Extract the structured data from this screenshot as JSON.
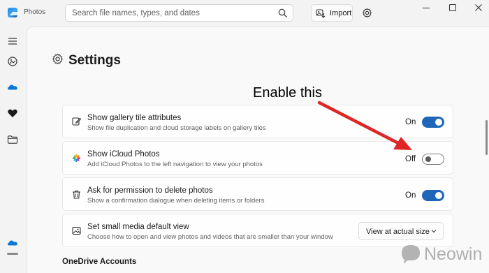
{
  "titlebar": {
    "app_title": "Photos",
    "search_placeholder": "Search file names, types, and dates",
    "import_label": "Import"
  },
  "page": {
    "title": "Settings",
    "annotation": "Enable this"
  },
  "settings": [
    {
      "title": "Show gallery tile attributes",
      "subtitle": "Show file duplication and cloud storage labels on gallery tiles",
      "toggle_label": "On",
      "toggle_state": true,
      "icon": "edit-icon"
    },
    {
      "title": "Show iCloud Photos",
      "subtitle": "Add iCloud Photos to the left navigation to view your photos",
      "toggle_label": "Off",
      "toggle_state": false,
      "icon": "icloud-photos-icon"
    },
    {
      "title": "Ask for permission to delete photos",
      "subtitle": "Show a confirmation dialogue when deleting items or folders",
      "toggle_label": "On",
      "toggle_state": true,
      "icon": "trash-icon"
    },
    {
      "title": "Set small media default view",
      "subtitle": "Choose how to open and view photos and videos that are smaller than your window",
      "dropdown_value": "View at actual size",
      "icon": "image-icon"
    }
  ],
  "section": {
    "onedrive_title": "OneDrive Accounts"
  },
  "watermark": {
    "text": "Neowin"
  },
  "colors": {
    "accent": "#1f66b8",
    "annotation_arrow": "#e02525",
    "onedrive": "#0f78d4"
  }
}
